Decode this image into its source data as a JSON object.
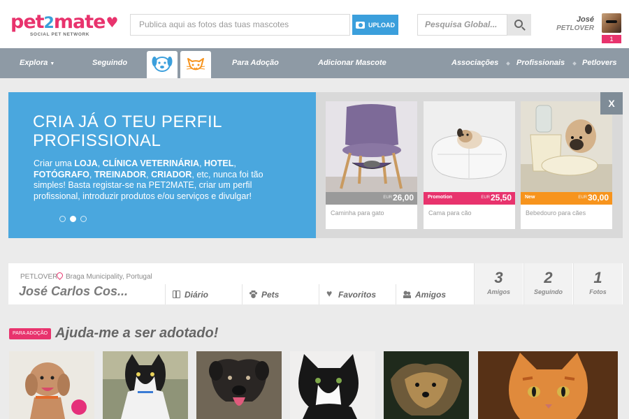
{
  "brand": {
    "logo_main": "pet",
    "logo_two": "2",
    "logo_rest": "mate",
    "tagline": "SOCIAL PET NETWORK",
    "pink": "#e8336d",
    "blue": "#3b9fdc"
  },
  "header": {
    "upload_placeholder": "Publica aqui as fotos das tuas mascotes",
    "upload_label": "UPLOAD",
    "search_placeholder": "Pesquisa Global...",
    "user_first_name": "José",
    "user_role": "PETLOVER",
    "notification_count": "1"
  },
  "nav": {
    "explore": "Explora",
    "following": "Seguindo",
    "adoption": "Para Adoção",
    "add_pet": "Adicionar Mascote",
    "associations": "Associações",
    "professionals": "Profissionais",
    "petlovers": "Petlovers",
    "species_tabs": [
      "dog-icon",
      "cat-icon"
    ]
  },
  "banner": {
    "title": "CRIA JÁ O TEU PERFIL PROFISSIONAL",
    "text_parts": [
      "Criar uma ",
      "LOJA",
      ", ",
      "CLÍNICA VETERINÁRIA",
      ", ",
      "HOTEL",
      ", ",
      "FOTÓGRAFO",
      ", ",
      "TREINADOR",
      ", ",
      "CRIADOR",
      ", etc,  nunca foi tão simples! Basta registar-se na PET2MATE,  criar um perfil profissional, introduzir produtos e/ou serviços e divulgar!"
    ],
    "close_label": "X",
    "slide_count": 3,
    "active_slide": 2,
    "products": [
      {
        "tag": "",
        "currency": "EUR",
        "price": "26,00",
        "name": "Caminha para gato",
        "strip_color": "#9a9a9a"
      },
      {
        "tag": "Promotion",
        "currency": "EUR",
        "price": "25,50",
        "name": "Cama para cão",
        "strip_color": "#e8336d"
      },
      {
        "tag": "New",
        "currency": "EUR",
        "price": "30,00",
        "name": "Bebedouro para cães",
        "strip_color": "#f7941d"
      }
    ]
  },
  "profile": {
    "role": "PETLOVER",
    "location": "Braga Municipality, Portugal",
    "name": "José Carlos Cos...",
    "tabs": [
      "Diário",
      "Pets",
      "Favoritos",
      "Amigos"
    ],
    "stats": [
      {
        "value": "3",
        "label": "Amigos"
      },
      {
        "value": "2",
        "label": "Seguindo"
      },
      {
        "value": "1",
        "label": "Fotos"
      }
    ]
  },
  "adoption": {
    "badge": "PARA ADOÇÃO",
    "title": "Ajuda-me a ser adotado!"
  }
}
